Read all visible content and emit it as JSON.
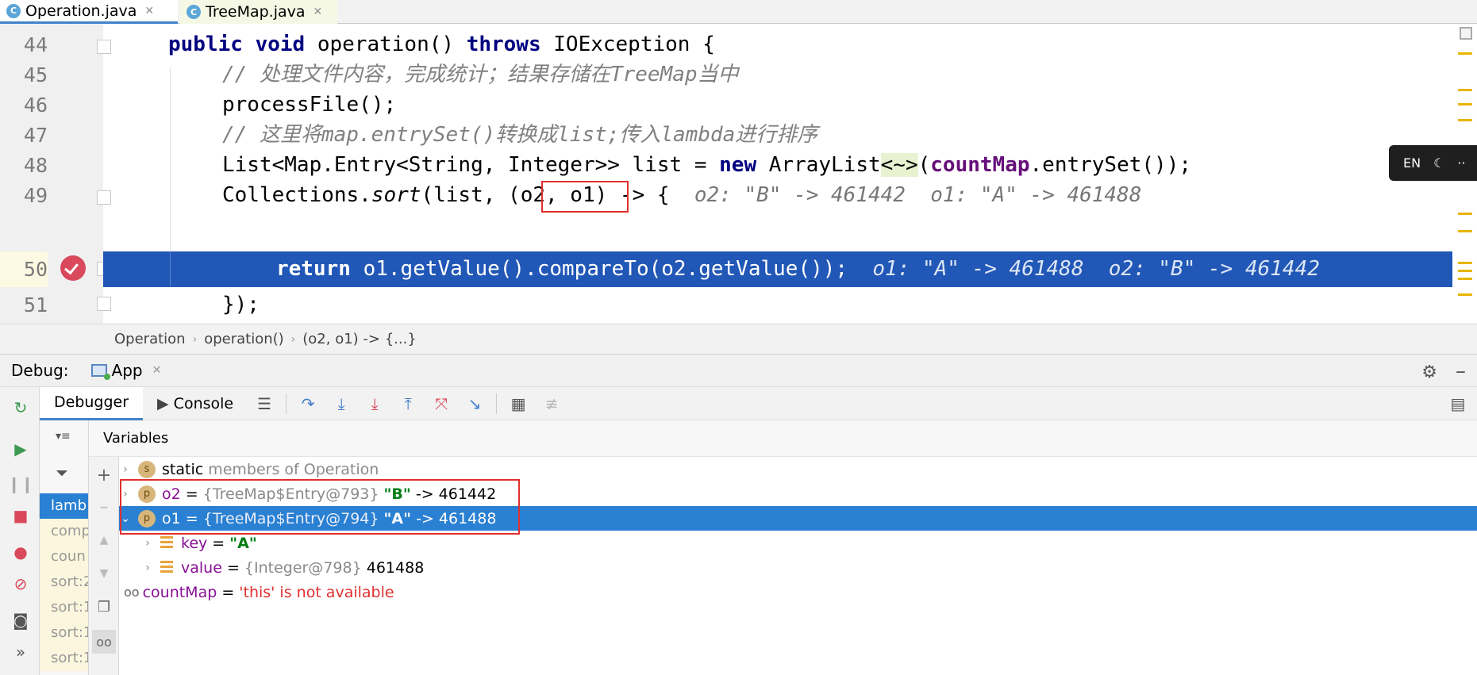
{
  "tabs": [
    {
      "label": "Operation.java",
      "icon": "class-icon",
      "active": true
    },
    {
      "label": "TreeMap.java",
      "icon": "class-icon",
      "active": false
    }
  ],
  "editor": {
    "lines": [
      {
        "num": "44",
        "text": "public void operation() throws IOException {"
      },
      {
        "num": "45",
        "text": "// 处理文件内容，完成统计；结果存储在TreeMap当中"
      },
      {
        "num": "46",
        "text": "processFile();"
      },
      {
        "num": "47",
        "text": "// 这里将map.entrySet()转换成list;传入lambda进行排序"
      },
      {
        "num": "48",
        "text": "List<Map.Entry<String, Integer>> list = new ArrayList<~>(countMap.entrySet());"
      },
      {
        "num": "49",
        "text": "Collections.sort(list, (o2, o1) -> {",
        "hint": "o2: \"B\" -> 461442  o1: \"A\" -> 461488"
      },
      {
        "num": "50",
        "text": "return o1.getValue().compareTo(o2.getValue());",
        "hint": "o1: \"A\" -> 461488  o2: \"B\" -> 461442",
        "current": true
      },
      {
        "num": "51",
        "text": "});"
      }
    ]
  },
  "ime": {
    "lang": "EN"
  },
  "breadcrumb": [
    "Operation",
    "operation()",
    "(o2, o1) -> {...}"
  ],
  "debug": {
    "title": "Debug:",
    "config": "App",
    "tabs": {
      "debugger": "Debugger",
      "console": "Console"
    },
    "variables_title": "Variables",
    "frames": [
      "lamb",
      "comp",
      "coun",
      "sort:2",
      "sort:1",
      "sort:1",
      "sort:1"
    ],
    "vars": [
      {
        "name": "static",
        "rest": " members of Operation"
      },
      {
        "name": "o2",
        "ref": "{TreeMap$Entry@793}",
        "key": "\"B\"",
        "val": "461442"
      },
      {
        "name": "o1",
        "ref": "{TreeMap$Entry@794}",
        "key": "\"A\"",
        "val": "461488"
      },
      {
        "name": "key",
        "val": "\"A\""
      },
      {
        "name": "value",
        "ref": "{Integer@798}",
        "val": "461488"
      },
      {
        "name": "countMap",
        "val": "'this' is not available"
      }
    ]
  }
}
